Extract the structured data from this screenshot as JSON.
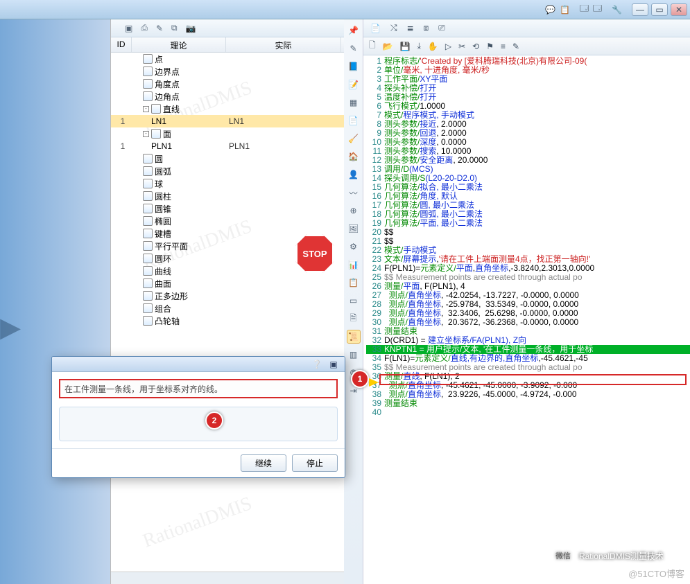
{
  "titlebar": {
    "min": "—",
    "max": "▭",
    "close": "✕"
  },
  "cols": {
    "id": "ID",
    "name": "理论",
    "act": "实际"
  },
  "tree": [
    {
      "exp": "",
      "ind": 1,
      "icon": "pt",
      "label": "点",
      "id": "",
      "act": ""
    },
    {
      "exp": "",
      "ind": 1,
      "icon": "ept",
      "label": "边界点",
      "id": "",
      "act": ""
    },
    {
      "exp": "",
      "ind": 1,
      "icon": "apt",
      "label": "角度点",
      "id": "",
      "act": ""
    },
    {
      "exp": "",
      "ind": 1,
      "icon": "cpt",
      "label": "边角点",
      "id": "",
      "act": ""
    },
    {
      "exp": "-",
      "ind": 1,
      "icon": "ln",
      "label": "直线",
      "id": "",
      "act": ""
    },
    {
      "exp": "",
      "ind": 2,
      "icon": "",
      "label": "LN1",
      "id": "1",
      "act": "LN1",
      "sel": true
    },
    {
      "exp": "-",
      "ind": 1,
      "icon": "pl",
      "label": "面",
      "id": "",
      "act": ""
    },
    {
      "exp": "",
      "ind": 2,
      "icon": "",
      "label": "PLN1",
      "id": "1",
      "act": "PLN1"
    },
    {
      "exp": "",
      "ind": 1,
      "icon": "ci",
      "label": "圆",
      "id": "",
      "act": ""
    },
    {
      "exp": "",
      "ind": 1,
      "icon": "ar",
      "label": "圆弧",
      "id": "",
      "act": ""
    },
    {
      "exp": "",
      "ind": 1,
      "icon": "sp",
      "label": "球",
      "id": "",
      "act": ""
    },
    {
      "exp": "",
      "ind": 1,
      "icon": "cy",
      "label": "圆柱",
      "id": "",
      "act": ""
    },
    {
      "exp": "",
      "ind": 1,
      "icon": "co",
      "label": "圆锥",
      "id": "",
      "act": ""
    },
    {
      "exp": "",
      "ind": 1,
      "icon": "el",
      "label": "椭圆",
      "id": "",
      "act": ""
    },
    {
      "exp": "",
      "ind": 1,
      "icon": "sl",
      "label": "键槽",
      "id": "",
      "act": ""
    },
    {
      "exp": "",
      "ind": 1,
      "icon": "pp",
      "label": "平行平面",
      "id": "",
      "act": ""
    },
    {
      "exp": "",
      "ind": 1,
      "icon": "to",
      "label": "圆环",
      "id": "",
      "act": ""
    },
    {
      "exp": "",
      "ind": 1,
      "icon": "cv",
      "label": "曲线",
      "id": "",
      "act": ""
    },
    {
      "exp": "",
      "ind": 1,
      "icon": "sf",
      "label": "曲面",
      "id": "",
      "act": ""
    },
    {
      "exp": "",
      "ind": 1,
      "icon": "pg",
      "label": "正多边形",
      "id": "",
      "act": ""
    },
    {
      "exp": "",
      "ind": 1,
      "icon": "cm",
      "label": "组合",
      "id": "",
      "act": ""
    },
    {
      "exp": "",
      "ind": 1,
      "icon": "ca",
      "label": "凸轮轴",
      "id": "",
      "act": ""
    }
  ],
  "stop": "STOP",
  "code": [
    {
      "n": 1,
      "seg": [
        {
          "c": "cg",
          "t": "程序标志/"
        },
        {
          "c": "cr",
          "t": "'Created by [爱科腾瑞科技(北京)有限公司-09("
        }
      ]
    },
    {
      "n": 2,
      "seg": [
        {
          "c": "cg",
          "t": "单位/"
        },
        {
          "c": "cr",
          "t": "毫米, 十进角度, 毫米/秒"
        }
      ]
    },
    {
      "n": 3,
      "seg": [
        {
          "c": "cg",
          "t": "工作平面/"
        },
        {
          "c": "cb",
          "t": "XY平面"
        }
      ]
    },
    {
      "n": 4,
      "seg": [
        {
          "c": "cg",
          "t": "探头补偿/"
        },
        {
          "c": "cb",
          "t": "打开"
        }
      ]
    },
    {
      "n": 5,
      "seg": [
        {
          "c": "cg",
          "t": "温度补偿/"
        },
        {
          "c": "cb",
          "t": "打开"
        }
      ]
    },
    {
      "n": 6,
      "seg": [
        {
          "c": "cg",
          "t": "飞行模式/"
        },
        {
          "c": "ck",
          "t": "1.0000"
        }
      ]
    },
    {
      "n": 7,
      "seg": [
        {
          "c": "cg",
          "t": "模式/"
        },
        {
          "c": "cb",
          "t": "程序模式, 手动模式"
        }
      ]
    },
    {
      "n": 8,
      "seg": [
        {
          "c": "cg",
          "t": "测头参数/"
        },
        {
          "c": "cb",
          "t": "接近"
        },
        {
          "c": "ck",
          "t": ", 2.0000"
        }
      ]
    },
    {
      "n": 9,
      "seg": [
        {
          "c": "cg",
          "t": "测头参数/"
        },
        {
          "c": "cb",
          "t": "回退"
        },
        {
          "c": "ck",
          "t": ", 2.0000"
        }
      ]
    },
    {
      "n": 10,
      "seg": [
        {
          "c": "cg",
          "t": "测头参数/"
        },
        {
          "c": "cb",
          "t": "深度"
        },
        {
          "c": "ck",
          "t": ", 0.0000"
        }
      ]
    },
    {
      "n": 11,
      "seg": [
        {
          "c": "cg",
          "t": "测头参数/"
        },
        {
          "c": "cb",
          "t": "搜索"
        },
        {
          "c": "ck",
          "t": ", 10.0000"
        }
      ]
    },
    {
      "n": 12,
      "seg": [
        {
          "c": "cg",
          "t": "测头参数/"
        },
        {
          "c": "cb",
          "t": "安全距离"
        },
        {
          "c": "ck",
          "t": ", 20.0000"
        }
      ]
    },
    {
      "n": 13,
      "seg": [
        {
          "c": "cg",
          "t": "调用/D"
        },
        {
          "c": "cb",
          "t": "(MCS)"
        }
      ]
    },
    {
      "n": 14,
      "seg": [
        {
          "c": "cg",
          "t": "探头调用/S"
        },
        {
          "c": "cb",
          "t": "(L20-20-D2.0)"
        }
      ]
    },
    {
      "n": 15,
      "seg": [
        {
          "c": "cg",
          "t": "几何算法/"
        },
        {
          "c": "cb",
          "t": "拟合, 最小二乘法"
        }
      ]
    },
    {
      "n": 16,
      "seg": [
        {
          "c": "cg",
          "t": "几何算法/"
        },
        {
          "c": "cb",
          "t": "角度, 默认"
        }
      ]
    },
    {
      "n": 17,
      "seg": [
        {
          "c": "cg",
          "t": "几何算法/"
        },
        {
          "c": "cb",
          "t": "圆, 最小二乘法"
        }
      ]
    },
    {
      "n": 18,
      "seg": [
        {
          "c": "cg",
          "t": "几何算法/"
        },
        {
          "c": "cb",
          "t": "圆弧, 最小二乘法"
        }
      ]
    },
    {
      "n": 19,
      "seg": [
        {
          "c": "cg",
          "t": "几何算法/"
        },
        {
          "c": "cb",
          "t": "平面, 最小二乘法"
        }
      ]
    },
    {
      "n": 20,
      "seg": [
        {
          "c": "ck",
          "t": "$$"
        }
      ]
    },
    {
      "n": 21,
      "seg": [
        {
          "c": "ck",
          "t": "$$"
        }
      ]
    },
    {
      "n": 22,
      "bp": true,
      "seg": [
        {
          "c": "cg",
          "t": "模式/"
        },
        {
          "c": "cb",
          "t": "手动模式"
        }
      ]
    },
    {
      "n": 23,
      "seg": [
        {
          "c": "cg",
          "t": "文本/"
        },
        {
          "c": "cb",
          "t": "屏幕提示"
        },
        {
          "c": "ck",
          "t": ","
        },
        {
          "c": "cr",
          "t": "'请在工件上端面测量4点，找正第一轴向!'"
        }
      ]
    },
    {
      "n": 24,
      "seg": [
        {
          "c": "ck",
          "t": "F(PLN1)="
        },
        {
          "c": "cg",
          "t": "元素定义/"
        },
        {
          "c": "cb",
          "t": "平面"
        },
        {
          "c": "ck",
          "t": ","
        },
        {
          "c": "cb",
          "t": "直角坐标"
        },
        {
          "c": "ck",
          "t": ",-3.8240,2.3013,0.0000"
        }
      ]
    },
    {
      "n": 25,
      "seg": [
        {
          "c": "cgy",
          "t": "$$ Measurement points are created through actual po"
        }
      ]
    },
    {
      "n": 26,
      "seg": [
        {
          "c": "cg",
          "t": "测量/"
        },
        {
          "c": "cb",
          "t": "平面"
        },
        {
          "c": "ck",
          "t": ", F(PLN1), 4"
        }
      ]
    },
    {
      "n": 27,
      "seg": [
        {
          "c": "cg",
          "t": "  测点/"
        },
        {
          "c": "cb",
          "t": "直角坐标"
        },
        {
          "c": "ck",
          "t": ", -42.0254, -13.7227, -0.0000, 0.0000"
        }
      ]
    },
    {
      "n": 28,
      "seg": [
        {
          "c": "cg",
          "t": "  测点/"
        },
        {
          "c": "cb",
          "t": "直角坐标"
        },
        {
          "c": "ck",
          "t": ", -25.9784,  33.5349, -0.0000, 0.0000"
        }
      ]
    },
    {
      "n": 29,
      "seg": [
        {
          "c": "cg",
          "t": "  测点/"
        },
        {
          "c": "cb",
          "t": "直角坐标"
        },
        {
          "c": "ck",
          "t": ",  32.3406,  25.6298, -0.0000, 0.0000"
        }
      ]
    },
    {
      "n": 30,
      "seg": [
        {
          "c": "cg",
          "t": "  测点/"
        },
        {
          "c": "cb",
          "t": "直角坐标"
        },
        {
          "c": "ck",
          "t": ",  20.3672, -36.2368, -0.0000, 0.0000"
        }
      ]
    },
    {
      "n": 31,
      "seg": [
        {
          "c": "cg",
          "t": "测量结束"
        }
      ]
    },
    {
      "n": 32,
      "seg": [
        {
          "c": "ck",
          "t": "D(CRD1) = "
        },
        {
          "c": "cb",
          "t": "建立坐标系/FA(PLN1), Z向"
        }
      ]
    },
    {
      "n": 33,
      "hl": true,
      "seg": [
        {
          "c": "ck",
          "t": "KNPTN1 = 用户提示/文本, '在工件测量一条线，用于坐标"
        }
      ]
    },
    {
      "n": 34,
      "seg": [
        {
          "c": "ck",
          "t": "F(LN1)="
        },
        {
          "c": "cg",
          "t": "元素定义/"
        },
        {
          "c": "cb",
          "t": "直线,有边界的,直角坐标"
        },
        {
          "c": "ck",
          "t": ",-45.4621,-45"
        }
      ]
    },
    {
      "n": 35,
      "seg": [
        {
          "c": "cgy",
          "t": "$$ Measurement points are created through actual po"
        }
      ]
    },
    {
      "n": 36,
      "seg": [
        {
          "c": "cg",
          "t": "测量/"
        },
        {
          "c": "cb",
          "t": "直线"
        },
        {
          "c": "ck",
          "t": ", F(LN1), 2"
        }
      ]
    },
    {
      "n": 37,
      "seg": [
        {
          "c": "cg",
          "t": "  测点/"
        },
        {
          "c": "cb",
          "t": "直角坐标"
        },
        {
          "c": "ck",
          "t": ", -45.4621, -45.0000, -3.9092, -0.000"
        }
      ]
    },
    {
      "n": 38,
      "seg": [
        {
          "c": "cg",
          "t": "  测点/"
        },
        {
          "c": "cb",
          "t": "直角坐标"
        },
        {
          "c": "ck",
          "t": ",  23.9226, -45.0000, -4.9724, -0.000"
        }
      ]
    },
    {
      "n": 39,
      "seg": [
        {
          "c": "cg",
          "t": "测量结束"
        }
      ]
    },
    {
      "n": 40,
      "seg": [
        {
          "c": "ck",
          "t": ""
        }
      ]
    }
  ],
  "dialog": {
    "msg": "在工件测量一条线，用于坐标系对齐的线。",
    "ok": "继续",
    "stop": "停止"
  },
  "callout": {
    "c1": "1",
    "c2": "2"
  },
  "brand": "RationalDMIS测量技术",
  "watermark": "@51CTO博客"
}
